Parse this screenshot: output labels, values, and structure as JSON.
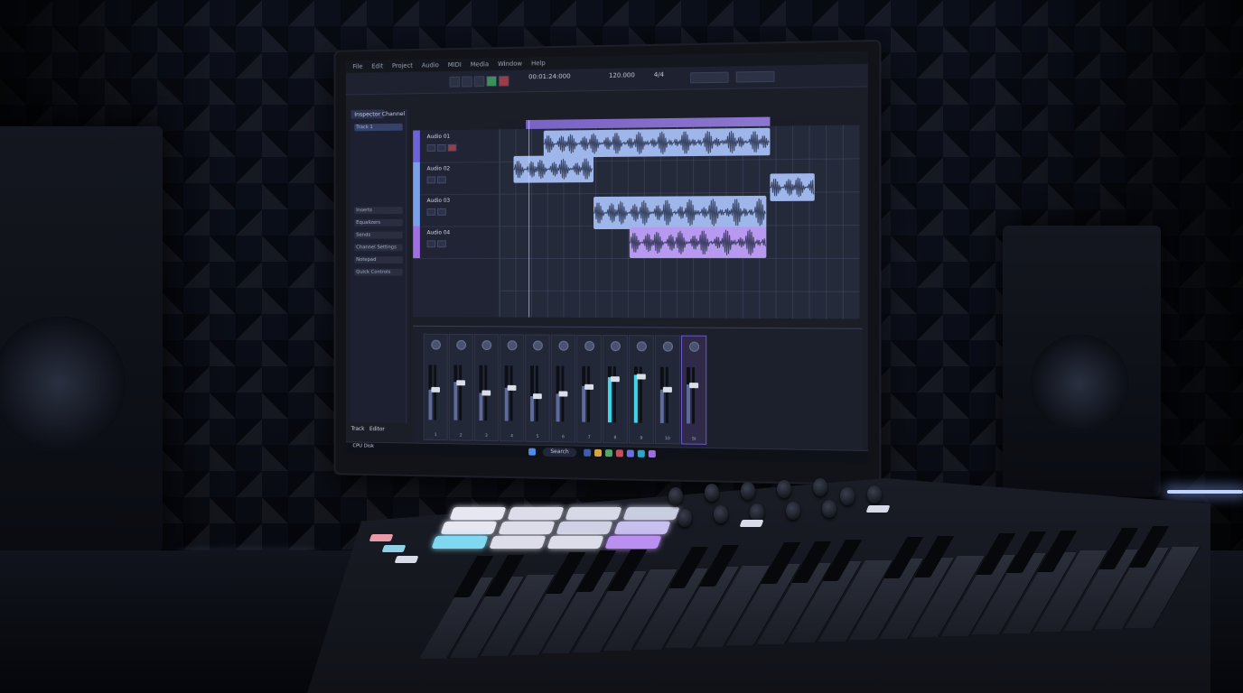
{
  "scene": {
    "description_tags": [
      "studio-desk",
      "computer-monitor",
      "daw-software",
      "midi-keyboard-controller",
      "studio-monitor-speakers",
      "acoustic-foam-wall"
    ]
  },
  "daw": {
    "menu": [
      "File",
      "Edit",
      "Project",
      "Audio",
      "MIDI",
      "Media",
      "Window",
      "Help"
    ],
    "transport_time": "00:01:24:000",
    "tempo": "120.000",
    "signature": "4/4",
    "sidebar_tabs": [
      "Inspector",
      "Channel"
    ],
    "sidebar_rows": [
      "Track 1",
      "Inserts",
      "Equalizers",
      "Sends",
      "Channel Settings",
      "Notepad",
      "Quick Controls"
    ],
    "tracks": [
      {
        "name": "Audio 01",
        "color": "#6f63d8"
      },
      {
        "name": "Audio 02",
        "color": "#7aa0e8"
      },
      {
        "name": "Audio 03",
        "color": "#7aa0e8"
      },
      {
        "name": "Audio 04",
        "color": "#a06fe0"
      }
    ],
    "mixer_channels": [
      "1",
      "2",
      "3",
      "4",
      "5",
      "6",
      "7",
      "8",
      "9",
      "10",
      "St"
    ],
    "search_label": "Search",
    "footer_tabs": [
      "Track",
      "Editor"
    ],
    "status_left": [
      "CPU",
      "Disk"
    ]
  },
  "colors": {
    "accent_purple": "#8a6fe0",
    "clip_blue": "#9fb6ea",
    "clip_purple": "#b79af0",
    "meter_cyan": "#3fd6e6",
    "led": "#bcd4ff"
  },
  "pads": [
    "#e7e7f2",
    "#dcdde8",
    "#d8d9e6",
    "#c9cde0",
    "#e7e7f2",
    "#dcdde8",
    "#cfd2e4",
    "#c8c0ee",
    "#7fd8ef",
    "#dcdde8",
    "#dcdde8",
    "#b98ff0"
  ]
}
